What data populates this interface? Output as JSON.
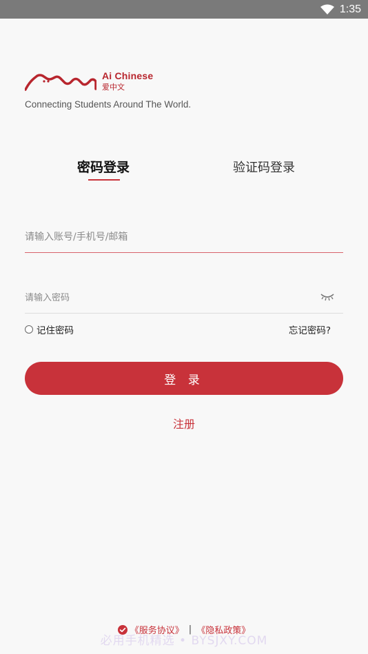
{
  "status_bar": {
    "time": "1:35",
    "wifi_icon": "wifi-icon"
  },
  "brand": {
    "name_en": "Ai Chinese",
    "name_cn": "爱中文",
    "tagline": "Connecting Students Around The World.",
    "color": "#b8262e"
  },
  "tabs": [
    {
      "label": "密码登录",
      "active": true
    },
    {
      "label": "验证码登录",
      "active": false
    }
  ],
  "form": {
    "account_placeholder": "请输入账号/手机号/邮箱",
    "password_placeholder": "请输入密码",
    "remember_label": "记住密码",
    "forgot_label": "忘记密码?",
    "login_label": "登 录",
    "register_label": "注册"
  },
  "agreement": {
    "service": "《服务协议》",
    "separator": "|",
    "privacy": "《隐私政策》",
    "checked": true
  },
  "watermark": "必用手机精选 • BYSJXY.COM",
  "theme": {
    "accent": "#c8323a"
  }
}
